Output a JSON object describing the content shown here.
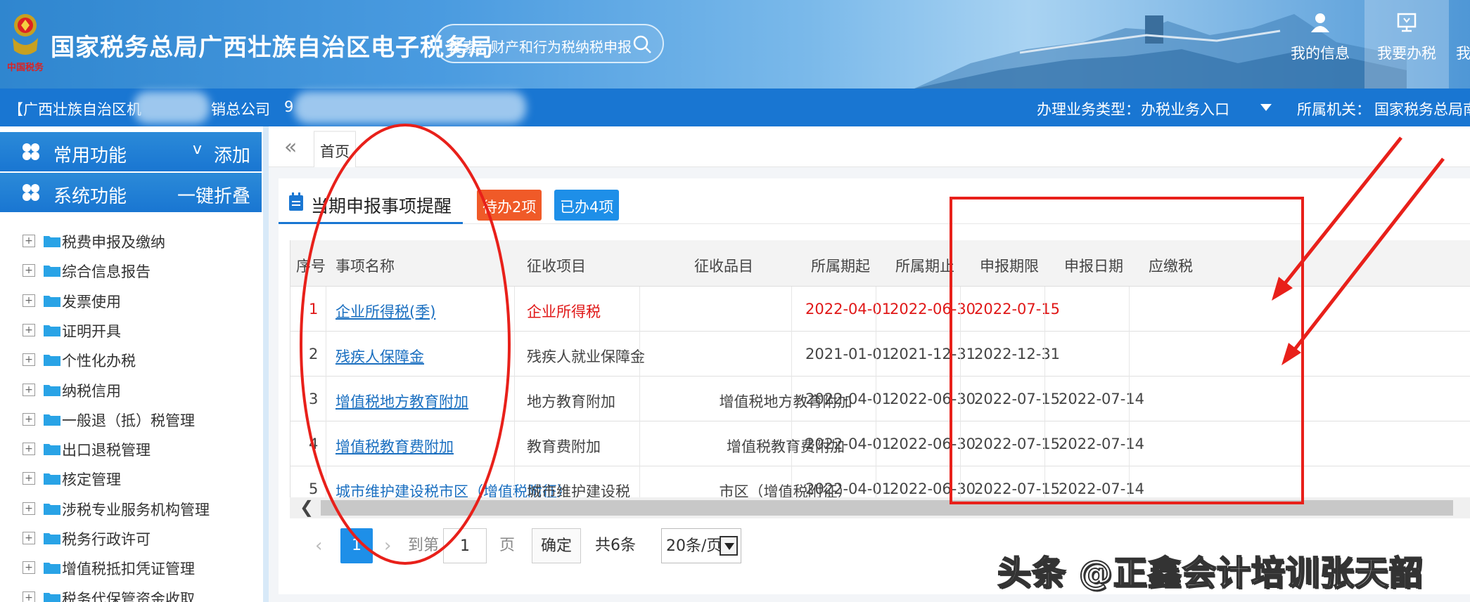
{
  "header": {
    "site_title": "国家税务总局广西壮族自治区电子税务局",
    "logo_text": "中国税务",
    "search_placeholder": "搜索：财产和行为税纳税申报",
    "nav": [
      {
        "label": "我的信息",
        "icon": "user-icon"
      },
      {
        "label": "我要办税",
        "icon": "computer-icon"
      },
      {
        "label": "我",
        "icon": "more-icon"
      }
    ]
  },
  "infobar": {
    "company_prefix": "【广西壮族自治区机",
    "company_suffix": "销总公司",
    "tax_id_prefix": "9",
    "business_type_label": "办理业务类型：",
    "business_type_value": "办税业务入口",
    "authority_label": "所属机关：",
    "authority_value": "国家税务总局南宁"
  },
  "sidebar": {
    "common": {
      "title": "常用功能",
      "chevron": "v",
      "action": "添加"
    },
    "system": {
      "title": "系统功能",
      "action": "一键折叠"
    },
    "items": [
      "税费申报及缴纳",
      "综合信息报告",
      "发票使用",
      "证明开具",
      "个性化办税",
      "纳税信用",
      "一般退（抵）税管理",
      "出口退税管理",
      "核定管理",
      "涉税专业服务机构管理",
      "税务行政许可",
      "增值税抵扣凭证管理",
      "税务代保管资金收取"
    ]
  },
  "tabs": {
    "collapse": "«",
    "home": "首页"
  },
  "panel": {
    "title": "当期申报事项提醒",
    "badge_todo": "待办2项",
    "badge_done": "已办4项"
  },
  "table": {
    "headers": [
      "序号",
      "事项名称",
      "征收项目",
      "征收品目",
      "所属期起",
      "所属期止",
      "申报期限",
      "申报日期",
      "应缴税"
    ],
    "rows": [
      {
        "no": "1",
        "name": "企业所得税(季)",
        "item": "企业所得税",
        "sub": "",
        "start": "2022-04-01",
        "end": "2022-06-30",
        "deadline": "2022-07-15",
        "date": "",
        "highlight": true
      },
      {
        "no": "2",
        "name": "残疾人保障金",
        "item": "残疾人就业保障金",
        "sub": "",
        "start": "2021-01-01",
        "end": "2021-12-31",
        "deadline": "2022-12-31",
        "date": "",
        "highlight": false
      },
      {
        "no": "3",
        "name": "增值税地方教育附加",
        "item": "地方教育附加",
        "sub": "增值税地方教育附加",
        "start": "2022-04-01",
        "end": "2022-06-30",
        "deadline": "2022-07-15",
        "date": "2022-07-14",
        "highlight": false
      },
      {
        "no": "4",
        "name": "增值税教育费附加",
        "item": "教育费附加",
        "sub": "增值税教育费附加",
        "start": "2022-04-01",
        "end": "2022-06-30",
        "deadline": "2022-07-15",
        "date": "2022-07-14",
        "highlight": false
      },
      {
        "no": "5",
        "name": "城市维护建设税市区（增值税附征）",
        "item": "城市维护建设税",
        "sub": "市区（增值税附征）",
        "start": "2022-04-01",
        "end": "2022-06-30",
        "deadline": "2022-07-15",
        "date": "2022-07-14",
        "highlight": false
      }
    ]
  },
  "pager": {
    "prev": "‹",
    "current": "1",
    "next": "›",
    "goto_label": "到第",
    "goto_value": "1",
    "page_label": "页",
    "confirm": "确定",
    "total": "共6条",
    "page_size": "20条/页"
  },
  "watermark": "头条 @正鑫会计培训张天韶",
  "colors": {
    "primary": "#1976d2",
    "todo": "#f05a28",
    "done": "#1e8fe8",
    "alert_red": "#e01818",
    "annotation_red": "#e8201a"
  }
}
